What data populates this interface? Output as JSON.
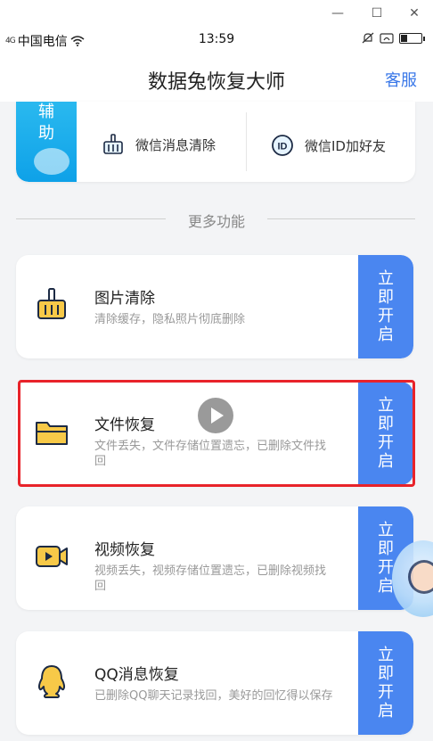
{
  "window": {
    "minimize": "—",
    "maximize": "☐",
    "close": "✕"
  },
  "status_bar": {
    "signal": "4G",
    "carrier": "中国电信",
    "time": "13:59",
    "battery_level": 0.3
  },
  "header": {
    "title": "数据兔恢复大师",
    "service": "客服"
  },
  "assist": {
    "tag": "辅\n助",
    "items": [
      {
        "label": "微信消息清除",
        "icon": "broom-icon"
      },
      {
        "label": "微信ID加好友",
        "icon": "id-icon"
      }
    ]
  },
  "section": {
    "title": "更多功能"
  },
  "features": [
    {
      "title": "图片清除",
      "desc": "清除缓存，隐私照片彻底删除",
      "button": [
        "立",
        "即",
        "开",
        "启"
      ],
      "icon": "broom-icon",
      "highlighted": false
    },
    {
      "title": "文件恢复",
      "desc": "文件丢失，文件存储位置遗忘，已删除文件找回",
      "button": [
        "立",
        "即",
        "开",
        "启"
      ],
      "icon": "folder-icon",
      "highlighted": true
    },
    {
      "title": "视频恢复",
      "desc": "视频丢失，视频存储位置遗忘，已删除视频找回",
      "button": [
        "立",
        "即",
        "开",
        "启"
      ],
      "icon": "video-icon",
      "highlighted": false
    },
    {
      "title": "QQ消息恢复",
      "desc": "已删除QQ聊天记录找回，美好的回忆得以保存",
      "button": [
        "立",
        "即",
        "开",
        "启"
      ],
      "icon": "qq-icon",
      "highlighted": false
    }
  ],
  "colors": {
    "accent": "#4a86f0",
    "service_link": "#3a78e8",
    "assist_tag": "#0ea1e8",
    "highlight": "#e8232a",
    "icon_yellow": "#f7c948"
  }
}
